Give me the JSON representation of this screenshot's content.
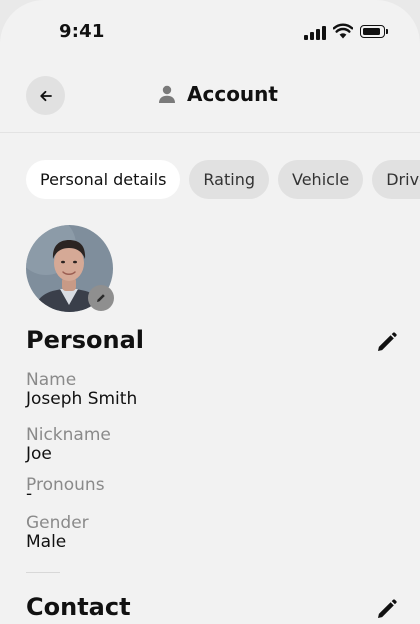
{
  "status_bar": {
    "time": "9:41"
  },
  "header": {
    "title": "Account"
  },
  "tabs": [
    {
      "label": "Personal details",
      "active": true
    },
    {
      "label": "Rating",
      "active": false
    },
    {
      "label": "Vehicle",
      "active": false
    },
    {
      "label": "Driver's license",
      "active": false
    }
  ],
  "personal": {
    "title": "Personal",
    "fields": [
      {
        "label": "Name",
        "value": "Joseph Smith"
      },
      {
        "label": "Nickname",
        "value": "Joe"
      },
      {
        "label": "Pronouns",
        "value": "-"
      },
      {
        "label": "Gender",
        "value": "Male"
      }
    ]
  },
  "contact": {
    "title": "Contact"
  },
  "colors": {
    "background": "#f2f2f2",
    "chip": "#e1e1e1",
    "chip_active": "#ffffff",
    "label": "#8a8a8a"
  }
}
